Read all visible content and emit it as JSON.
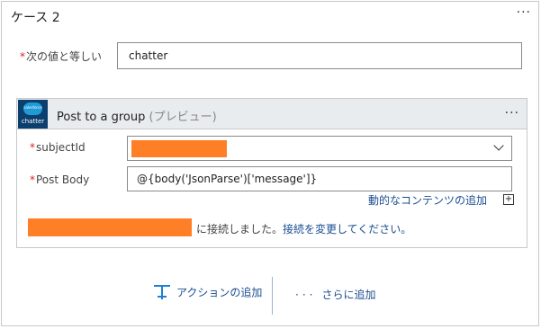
{
  "case": {
    "title": "ケース 2",
    "menu": "···"
  },
  "condition": {
    "label": "次の値と等しい",
    "required_mark": "*",
    "value": "chatter"
  },
  "action": {
    "logo_text": "chatter",
    "logo_cloud_text": "salesforce",
    "title": "Post to a group",
    "preview_tag": "(プレビュー)",
    "menu": "···",
    "fields": [
      {
        "label": "subjectId",
        "required_mark": "*",
        "value": ""
      },
      {
        "label": "Post Body",
        "required_mark": "*",
        "value": "@{body('JsonParse')['message']}"
      }
    ],
    "dynamic_content_link": "動的なコンテンツの追加",
    "plus_icon": "+",
    "connection_text": "に接続しました。",
    "change_connection_link": "接続を変更してください。"
  },
  "footer": {
    "add_action": "アクションの追加",
    "more_dots": "···",
    "add_more": "さらに追加"
  },
  "colors": {
    "redaction": "#ff7f27",
    "link": "#1a4d8f",
    "required": "#e02020"
  }
}
